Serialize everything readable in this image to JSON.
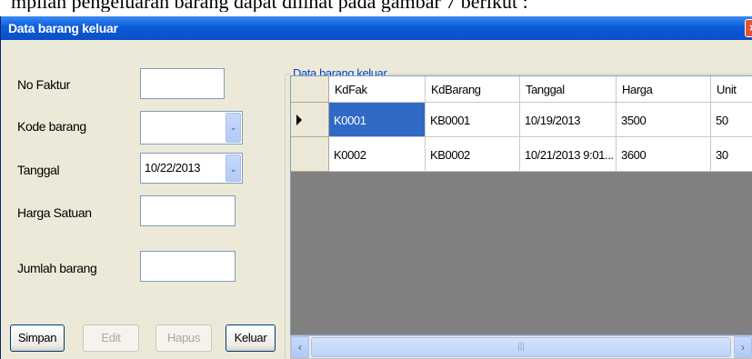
{
  "document": {
    "caption": "mpilan pengeluaran barang dapat dilihat pada gambar 7 berikut :"
  },
  "window": {
    "title": "Data barang keluar",
    "close_glyph": "×"
  },
  "form": {
    "no_faktur": {
      "label": "No Faktur",
      "value": ""
    },
    "kode_barang": {
      "label": "Kode barang",
      "value": ""
    },
    "tanggal": {
      "label": "Tanggal",
      "value": "10/22/2013"
    },
    "harga_satuan": {
      "label": "Harga Satuan",
      "value": ""
    },
    "jumlah_barang": {
      "label": "Jumlah barang",
      "value": ""
    },
    "dropdown_glyph": "⌄"
  },
  "buttons": {
    "simpan": "Simpan",
    "edit": "Edit",
    "hapus": "Hapus",
    "keluar": "Keluar"
  },
  "grid": {
    "group_title": "Data barang keluar",
    "columns": [
      "KdFak",
      "KdBarang",
      "Tanggal",
      "Harga",
      "Unit"
    ],
    "rows": [
      [
        "K0001",
        "KB0001",
        "10/19/2013",
        "3500",
        "50"
      ],
      [
        "K0002",
        "KB0002",
        "10/21/2013 9:01...",
        "3600",
        "30"
      ]
    ],
    "selected_row": 0
  },
  "scrollbar": {
    "left_glyph": "‹",
    "right_glyph": "›",
    "grip_glyph": "|||"
  },
  "colors": {
    "titlebar": "#0b5bd8",
    "selection": "#316ac5",
    "grid_background": "#808080",
    "group_title": "#0046d5"
  }
}
